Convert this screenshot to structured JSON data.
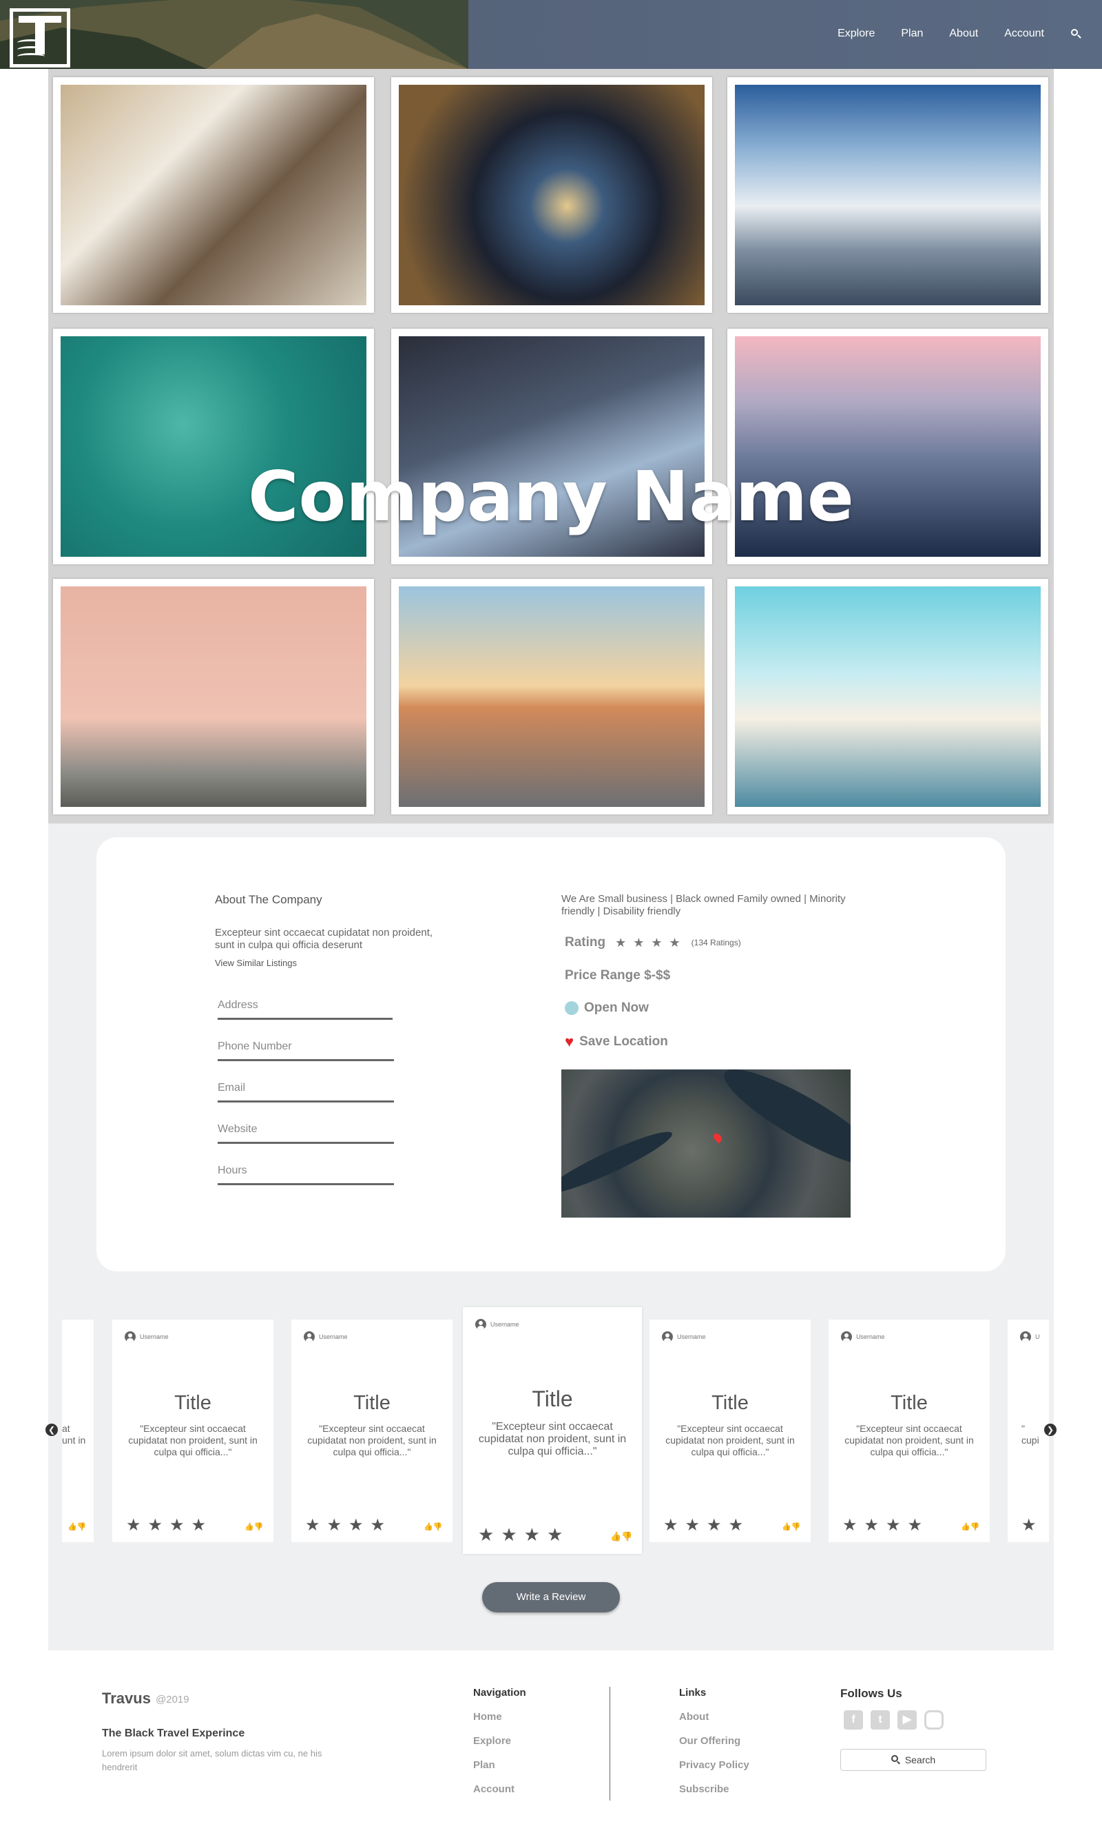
{
  "header": {
    "nav": [
      "Explore",
      "Plan",
      "About",
      "Account"
    ],
    "search_icon": "search-icon"
  },
  "hero": {
    "company_name": "Company Name",
    "photos": [
      "laptop-desk",
      "ramen-bowl",
      "airplane-clouds",
      "swimmer-ocean",
      "traveler-airport-board",
      "city-mountain",
      "pink-building",
      "eiffel-phone",
      "airport-window-silhouette"
    ]
  },
  "about": {
    "title": "About The Company",
    "description": "Excepteur sint occaecat cupidatat non proident, sunt in culpa qui officia deserunt",
    "view_similar": "View Similar Listings",
    "fields": [
      "Address",
      "Phone Number",
      "Email",
      "Website",
      "Hours"
    ]
  },
  "business": {
    "tags": "We Are Small business | Black owned Family owned | Minority friendly | Disability friendly",
    "rating_label": "Rating",
    "rating_stars": 4,
    "rating_count": "(134 Ratings)",
    "price_range": "Price Range $-$$",
    "open_status": "Open Now",
    "save_location": "Save Location"
  },
  "reviews": {
    "cards": [
      {
        "username": "Username",
        "title": "Title",
        "quote": "\"Excepteur sint occaecat cupidatat non proident, sunt in culpa qui officia...\"",
        "stars": 4
      },
      {
        "username": "Username",
        "title": "Title",
        "quote": "\"Excepteur sint occaecat cupidatat non proident, sunt in culpa qui officia...\"",
        "stars": 4
      },
      {
        "username": "Username",
        "title": "Title",
        "quote": "\"Excepteur sint occaecat cupidatat non proident, sunt in culpa qui officia...\"",
        "stars": 4
      },
      {
        "username": "Username",
        "title": "Title",
        "quote": "\"Excepteur sint occaecat cupidatat non proident, sunt in culpa qui officia...\"",
        "stars": 4
      },
      {
        "username": "Username",
        "title": "Title",
        "quote": "\"Excepteur sint occaecat cupidatat non proident, sunt in culpa qui officia...\"",
        "stars": 4
      }
    ],
    "partial_left_text": "at\nunt in",
    "partial_right_text": "\"\ncupi",
    "partial_right_user": "U",
    "write_review": "Write a Review"
  },
  "footer": {
    "brand": "Travus",
    "year": "@2019",
    "tagline": "The Black Travel Experince",
    "lorem": "Lorem ipsum dolor sit amet, solum dictas vim cu, ne his hendrerit",
    "nav_title": "Navigation",
    "nav_links": [
      "Home",
      "Explore",
      "Plan",
      "Account"
    ],
    "links_title": "Links",
    "links": [
      "About",
      "Our Offering",
      "Privacy Policy",
      "Subscribe"
    ],
    "follow_title": "Follows Us",
    "social": [
      {
        "name": "facebook-icon",
        "glyph": "f"
      },
      {
        "name": "twitter-icon",
        "glyph": "t"
      },
      {
        "name": "youtube-icon",
        "glyph": "▶"
      },
      {
        "name": "instagram-icon",
        "glyph": "◦"
      }
    ],
    "search_label": "Search"
  }
}
